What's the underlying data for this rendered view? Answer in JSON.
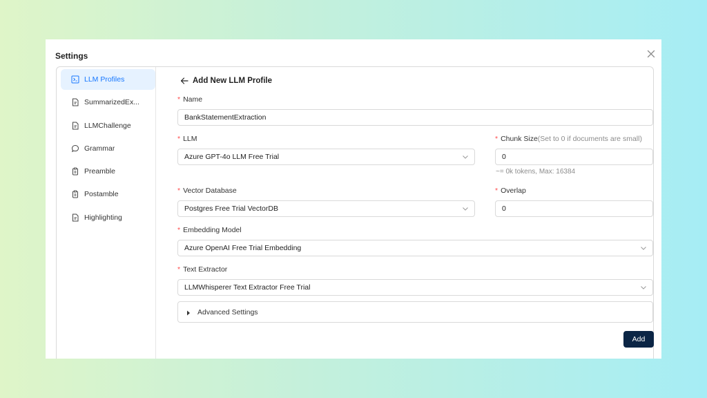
{
  "modal": {
    "title": "Settings"
  },
  "sidebar": {
    "items": [
      {
        "label": "LLM Profiles",
        "icon": "terminal-icon",
        "active": true
      },
      {
        "label": "SummarizedEx...",
        "icon": "document-icon",
        "active": false
      },
      {
        "label": "LLMChallenge",
        "icon": "document-icon",
        "active": false
      },
      {
        "label": "Grammar",
        "icon": "chat-bubble-icon",
        "active": false
      },
      {
        "label": "Preamble",
        "icon": "clipboard-icon",
        "active": false
      },
      {
        "label": "Postamble",
        "icon": "clipboard-icon",
        "active": false
      },
      {
        "label": "Highlighting",
        "icon": "document-icon",
        "active": false
      }
    ]
  },
  "form": {
    "header": "Add New LLM Profile",
    "name": {
      "label": "Name",
      "value": "BankStatementExtraction"
    },
    "llm": {
      "label": "LLM",
      "value": "Azure GPT-4o LLM Free Trial"
    },
    "chunk_size": {
      "label": "Chunk Size",
      "hint": "(Set to 0 if documents are small)",
      "value": "0",
      "help": "~= 0k tokens, Max: 16384"
    },
    "vector_db": {
      "label": "Vector Database",
      "value": "Postgres Free Trial VectorDB"
    },
    "overlap": {
      "label": "Overlap",
      "value": "0"
    },
    "embedding": {
      "label": "Embedding Model",
      "value": "Azure OpenAI Free Trial Embedding"
    },
    "text_extractor": {
      "label": "Text Extractor",
      "value": "LLMWhisperer Text Extractor Free Trial"
    },
    "advanced_label": "Advanced Settings",
    "add_label": "Add",
    "required_mark": "*"
  },
  "colors": {
    "accent": "#1677ff",
    "active_bg": "#e6f2ff",
    "required": "#ff4d4f",
    "button_bg": "#0b2545"
  }
}
